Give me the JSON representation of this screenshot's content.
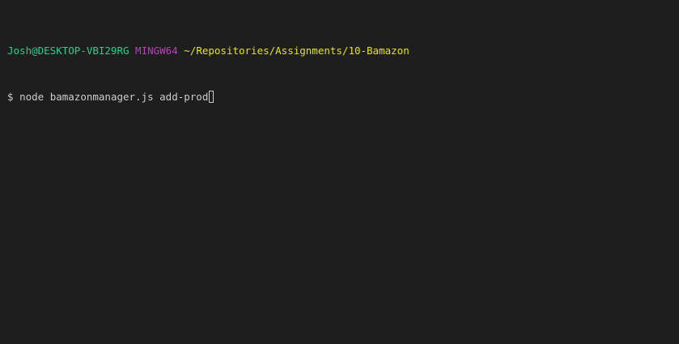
{
  "prompt_header": {
    "user_host": "Josh@DESKTOP-VBI29RG",
    "system": "MINGW64",
    "cwd": "~/Repositories/Assignments/10-Bamazon"
  },
  "command_line": {
    "prompt_symbol": "$",
    "input": "node bamazonmanager.js add-prod"
  },
  "colors": {
    "background": "#1e1e1e",
    "user_host": "#23d18b",
    "system": "#bc3fbc",
    "cwd": "#e5e510",
    "text": "#cccccc"
  }
}
